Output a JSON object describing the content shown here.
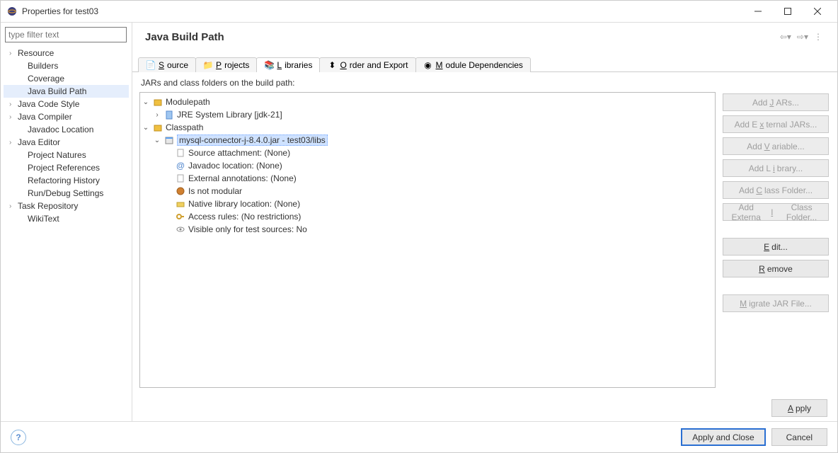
{
  "window": {
    "title": "Properties for test03"
  },
  "sidebar": {
    "filter_placeholder": "type filter text",
    "items": [
      {
        "label": "Resource",
        "expandable": true
      },
      {
        "label": "Builders"
      },
      {
        "label": "Coverage"
      },
      {
        "label": "Java Build Path",
        "selected": true
      },
      {
        "label": "Java Code Style",
        "expandable": true
      },
      {
        "label": "Java Compiler",
        "expandable": true
      },
      {
        "label": "Javadoc Location"
      },
      {
        "label": "Java Editor",
        "expandable": true
      },
      {
        "label": "Project Natures"
      },
      {
        "label": "Project References"
      },
      {
        "label": "Refactoring History"
      },
      {
        "label": "Run/Debug Settings"
      },
      {
        "label": "Task Repository",
        "expandable": true
      },
      {
        "label": "WikiText"
      }
    ]
  },
  "page": {
    "title": "Java Build Path",
    "tabs": [
      {
        "label": "Source",
        "mnemonic": "S"
      },
      {
        "label": "Projects",
        "mnemonic": "P"
      },
      {
        "label": "Libraries",
        "mnemonic": "L",
        "active": true
      },
      {
        "label": "Order and Export",
        "mnemonic": "O"
      },
      {
        "label": "Module Dependencies",
        "mnemonic": "M"
      }
    ],
    "list_caption": "JARs and class folders on the build path:",
    "tree": {
      "modulepath": {
        "label": "Modulepath",
        "children": [
          {
            "label": "JRE System Library [jdk-21]",
            "expandable": true
          }
        ]
      },
      "classpath": {
        "label": "Classpath",
        "entry": {
          "label": "mysql-connector-j-8.4.0.jar - test03/libs",
          "selected": true,
          "details": [
            "Source attachment: (None)",
            "Javadoc location: (None)",
            "External annotations: (None)",
            "Is not modular",
            "Native library location: (None)",
            "Access rules: (No restrictions)",
            "Visible only for test sources: No"
          ]
        }
      }
    },
    "buttons": {
      "add_jars": "Add JARs...",
      "add_external_jars": "Add External JARs...",
      "add_variable": "Add Variable...",
      "add_library": "Add Library...",
      "add_class_folder": "Add Class Folder...",
      "add_external_class_folder": "Add External Class Folder...",
      "edit": "Edit...",
      "remove": "Remove",
      "migrate": "Migrate JAR File...",
      "apply": "Apply"
    },
    "mnemonics": {
      "add_jars": "J",
      "add_external_jars": "x",
      "add_variable": "V",
      "add_library": "i",
      "add_class_folder": "C",
      "add_external_class_folder": "l",
      "edit": "E",
      "remove": "R",
      "migrate": "M",
      "apply": "A"
    }
  },
  "bottom": {
    "apply_close": "Apply and Close",
    "cancel": "Cancel"
  }
}
